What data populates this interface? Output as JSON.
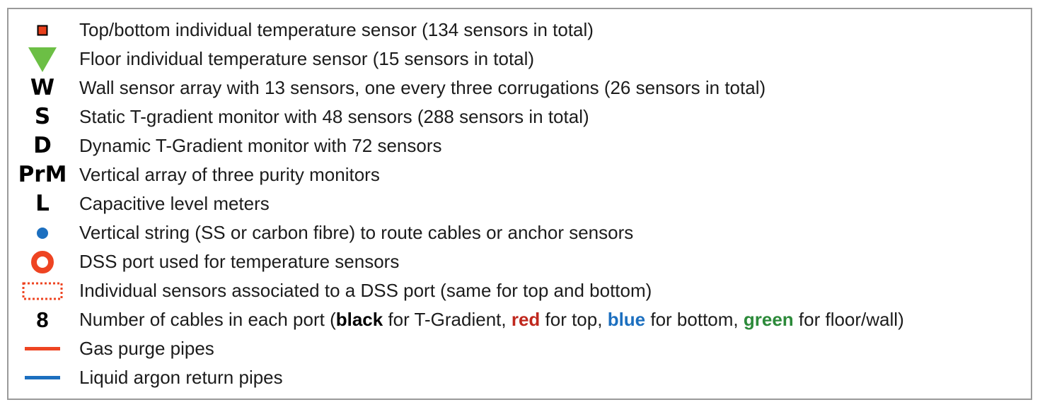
{
  "legend": {
    "items": [
      {
        "icon": "red-square-icon",
        "label": "Top/bottom individual temperature sensor  (134 sensors in total)"
      },
      {
        "icon": "green-triangle-icon",
        "label": "Floor individual temperature sensor  (15 sensors in total)"
      },
      {
        "icon": "letter-w",
        "symbol": "W",
        "label": "Wall sensor array with 13 sensors, one every three corrugations (26 sensors in total)"
      },
      {
        "icon": "letter-s",
        "symbol": "S",
        "label": "Static T-gradient monitor with 48 sensors  (288 sensors in total)"
      },
      {
        "icon": "letter-d",
        "symbol": "D",
        "label": "Dynamic T-Gradient monitor with 72 sensors"
      },
      {
        "icon": "letter-prm",
        "symbol": "PrM",
        "label": "Vertical array of three purity monitors"
      },
      {
        "icon": "letter-l",
        "symbol": "L",
        "label": "Capacitive level meters"
      },
      {
        "icon": "blue-dot-icon",
        "label": "Vertical string (SS or carbon fibre) to route cables or anchor sensors"
      },
      {
        "icon": "red-ring-icon",
        "label": "DSS port used for temperature sensors"
      },
      {
        "icon": "dotted-red-rectangle-icon",
        "label": "Individual sensors associated to a DSS port (same for top and bottom)"
      },
      {
        "icon": "number-8",
        "symbol": "8",
        "label_parts": {
          "p1": "Number of cables in each port (",
          "black": "black",
          "p2": " for T-Gradient, ",
          "red": "red",
          "p3": " for top, ",
          "blue": "blue",
          "p4": " for bottom, ",
          "green": "green",
          "p5": " for floor/wall)"
        }
      },
      {
        "icon": "red-line-icon",
        "label": "Gas purge pipes"
      },
      {
        "icon": "blue-line-icon",
        "label": "Liquid argon return pipes"
      }
    ]
  },
  "colors": {
    "sensor_red": "#e8401c",
    "floor_green": "#6cbf45",
    "string_blue": "#1c6fbf",
    "ring_red": "#ee4422",
    "text_red": "#c0281e",
    "text_blue": "#1c6fbf",
    "text_green": "#2c8a3a",
    "frame_grey": "#9a9a9a"
  }
}
